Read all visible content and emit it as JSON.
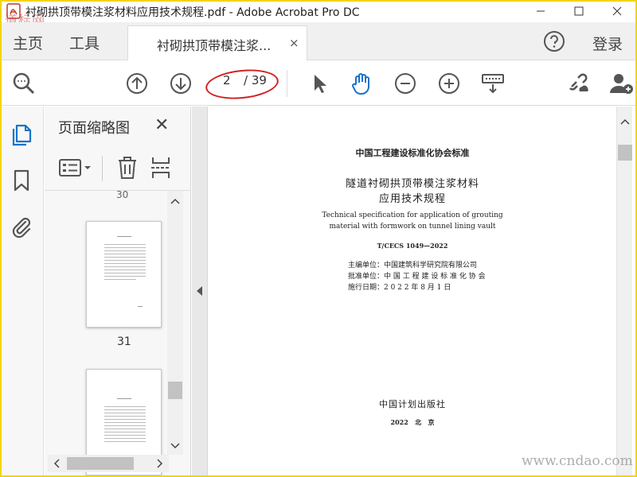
{
  "window": {
    "title": "衬砌拱顶带模注浆材料应用技术规程.pdf - Adobe Acrobat Pro DC",
    "watermark_top": "道标网"
  },
  "tabs": {
    "home": "主页",
    "tools": "工具",
    "document": "衬砌拱顶带模注浆...",
    "close": "×",
    "login": "登录"
  },
  "toolbar": {
    "current_page": "2",
    "page_total": "/ 39"
  },
  "panel": {
    "title": "页面缩略图",
    "close": "✕",
    "partial_label": "30",
    "thumbnails": [
      {
        "label": "31"
      },
      {
        "label": ""
      }
    ]
  },
  "document": {
    "association": "中国工程建设标准化协会标准",
    "title_line1": "隧道衬砌拱顶带模注浆材料",
    "title_line2": "应用技术规程",
    "english_line1": "Technical specification for application of grouting",
    "english_line2": "material with formwork on tunnel lining vault",
    "code": "T/CECS 1049—2022",
    "editor": "主编单位：中国建筑科学研究院有限公司",
    "approver": "批准单位：中 国 工 程 建 设 标 准 化 协 会",
    "date": "施行日期：2 0 2 2 年 8 月 1 日",
    "publisher": "中国计划出版社",
    "city_year": "2022   北   京"
  },
  "watermark": {
    "bottom": "www.cndao.com"
  },
  "colors": {
    "accent_blue": "#1a73c8",
    "annotation_red": "#d32020",
    "frame_yellow": "#f2d600"
  }
}
